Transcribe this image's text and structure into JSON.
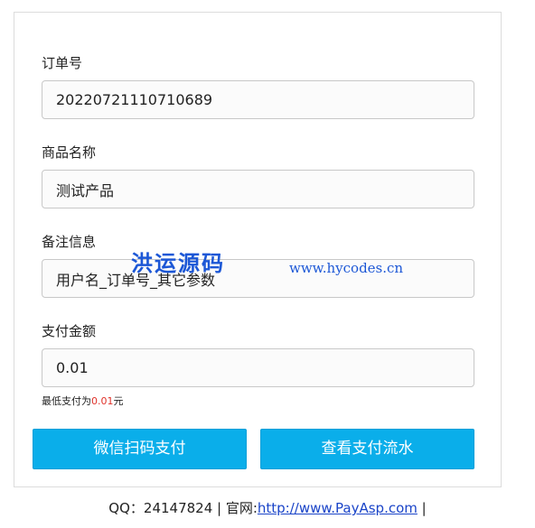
{
  "form": {
    "order_no_label": "订单号",
    "order_no_value": "20220721110710689",
    "product_label": "商品名称",
    "product_value": "测试产品",
    "remark_label": "备注信息",
    "remark_value": "用户名_订单号_其它参数",
    "amount_label": "支付金额",
    "amount_value": "0.01",
    "min_hint_prefix": "最低支付为",
    "min_hint_amount": "0.01",
    "min_hint_suffix": "元"
  },
  "buttons": {
    "wechat_pay": "微信扫码支付",
    "view_flow": "查看支付流水"
  },
  "watermark": {
    "brand": "洪运源码",
    "url": "www.hycodes.cn"
  },
  "footer": {
    "qq_label": "QQ：24147824 | 官网:",
    "site_link": "http://www.PayAsp.com",
    "trailing": " |"
  },
  "colors": {
    "button_bg": "#0aaeea",
    "hint_amount": "#e0312a",
    "link": "#1a44c8",
    "watermark": "#1c57d6"
  }
}
